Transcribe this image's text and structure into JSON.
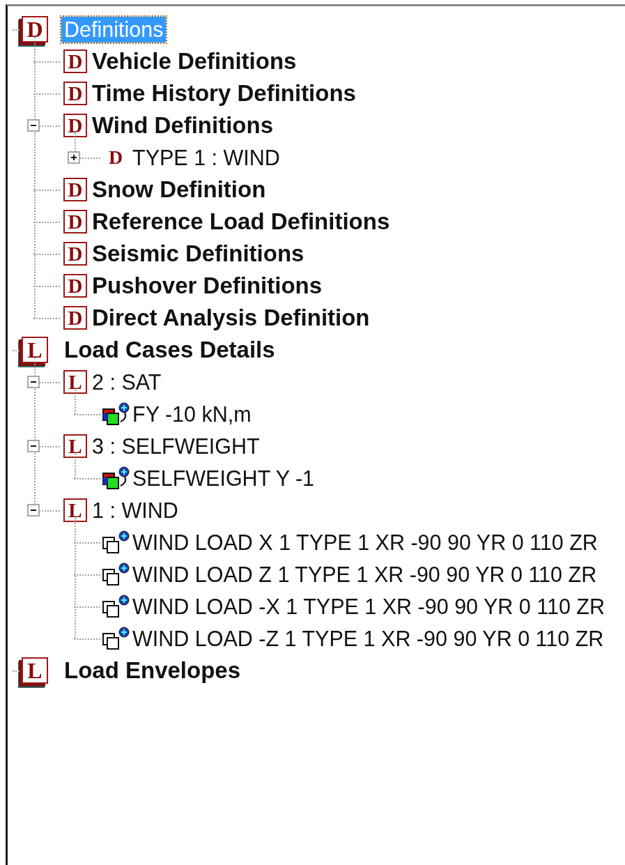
{
  "tree": [
    {
      "label": "Definitions",
      "kind": "stack",
      "letter": "D",
      "bold": false,
      "selected": true,
      "children": [
        {
          "label": "Vehicle Definitions",
          "kind": "box",
          "letter": "D",
          "bold": true,
          "selected": false
        },
        {
          "label": "Time History Definitions",
          "kind": "box",
          "letter": "D",
          "bold": true,
          "selected": false
        },
        {
          "label": "Wind Definitions",
          "kind": "box",
          "letter": "D",
          "bold": true,
          "selected": false,
          "expanded": true,
          "children": [
            {
              "label": "TYPE 1 : WIND",
              "kind": "plain",
              "letter": "D",
              "bold": false,
              "selected": false,
              "expanded": false
            }
          ]
        },
        {
          "label": "Snow Definition",
          "kind": "box",
          "letter": "D",
          "bold": true,
          "selected": false
        },
        {
          "label": "Reference Load Definitions",
          "kind": "box",
          "letter": "D",
          "bold": true,
          "selected": false
        },
        {
          "label": "Seismic Definitions",
          "kind": "box",
          "letter": "D",
          "bold": true,
          "selected": false
        },
        {
          "label": "Pushover Definitions",
          "kind": "box",
          "letter": "D",
          "bold": true,
          "selected": false
        },
        {
          "label": "Direct Analysis Definition",
          "kind": "box",
          "letter": "D",
          "bold": true,
          "selected": false
        }
      ]
    },
    {
      "label": "Load Cases Details",
      "kind": "stack",
      "letter": "L",
      "bold": true,
      "selected": false,
      "children": [
        {
          "label": "2 : SAT",
          "kind": "box",
          "letter": "L",
          "bold": false,
          "selected": false,
          "expanded": true,
          "children": [
            {
              "label": "FY -10 kN,m",
              "kind": "load-colored",
              "bold": false,
              "selected": false
            }
          ]
        },
        {
          "label": "3 : SELFWEIGHT",
          "kind": "box",
          "letter": "L",
          "bold": false,
          "selected": false,
          "expanded": true,
          "children": [
            {
              "label": "SELFWEIGHT Y -1",
              "kind": "load-colored",
              "bold": false,
              "selected": false
            }
          ]
        },
        {
          "label": "1 : WIND",
          "kind": "box",
          "letter": "L",
          "bold": false,
          "selected": false,
          "expanded": true,
          "children": [
            {
              "label": "WIND LOAD X 1 TYPE 1 XR -90 90 YR 0 110 ZR",
              "kind": "load-outline",
              "bold": false,
              "selected": false
            },
            {
              "label": "WIND LOAD Z 1 TYPE 1 XR -90 90 YR 0 110 ZR",
              "kind": "load-outline",
              "bold": false,
              "selected": false
            },
            {
              "label": "WIND LOAD -X 1 TYPE 1 XR -90 90 YR 0 110 ZR",
              "kind": "load-outline",
              "bold": false,
              "selected": false
            },
            {
              "label": "WIND LOAD -Z 1 TYPE 1 XR -90 90 YR 0 110 ZR",
              "kind": "load-outline",
              "bold": false,
              "selected": false
            }
          ]
        }
      ]
    },
    {
      "label": "Load Envelopes",
      "kind": "stack",
      "letter": "L",
      "bold": true,
      "selected": false
    }
  ]
}
